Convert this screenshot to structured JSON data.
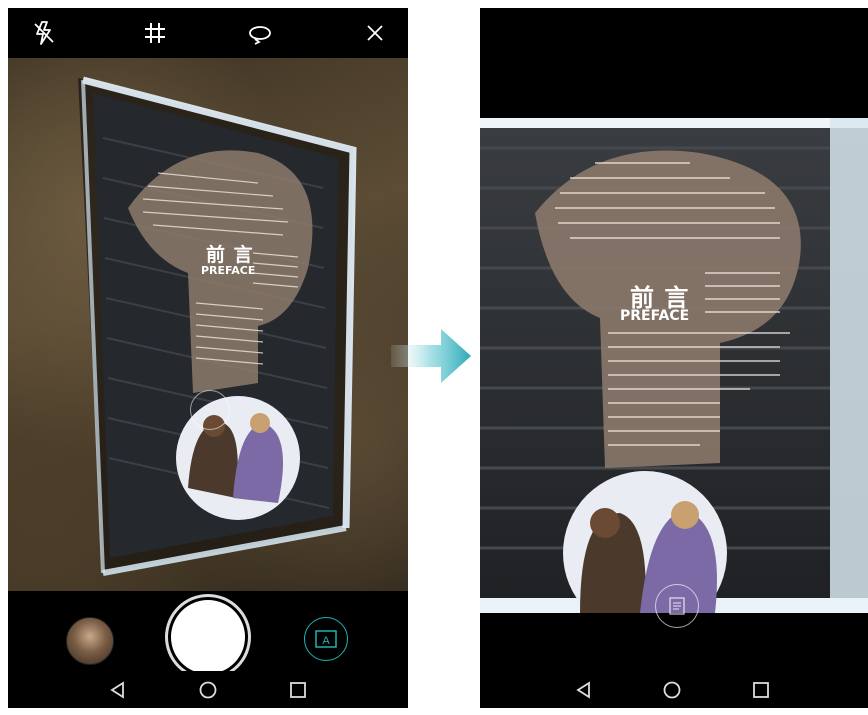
{
  "left_screen": {
    "toolbar": {
      "flash_icon": "flash-off-icon",
      "grid_icon": "grid-icon",
      "switch_icon": "rotate-camera-icon",
      "close_icon": "close-icon"
    },
    "sticker": {
      "title_cn": "前 言",
      "title_en": "PREFACE"
    },
    "mode_badge": "A"
  },
  "right_screen": {
    "sticker": {
      "title_cn": "前 言",
      "title_en": "PREFACE"
    }
  },
  "navbar": {
    "back_icon": "back-triangle-icon",
    "home_icon": "home-circle-icon",
    "recents_icon": "recents-square-icon"
  },
  "colors": {
    "accent": "#1fb3b3",
    "arrow": "#2aa9b5"
  }
}
